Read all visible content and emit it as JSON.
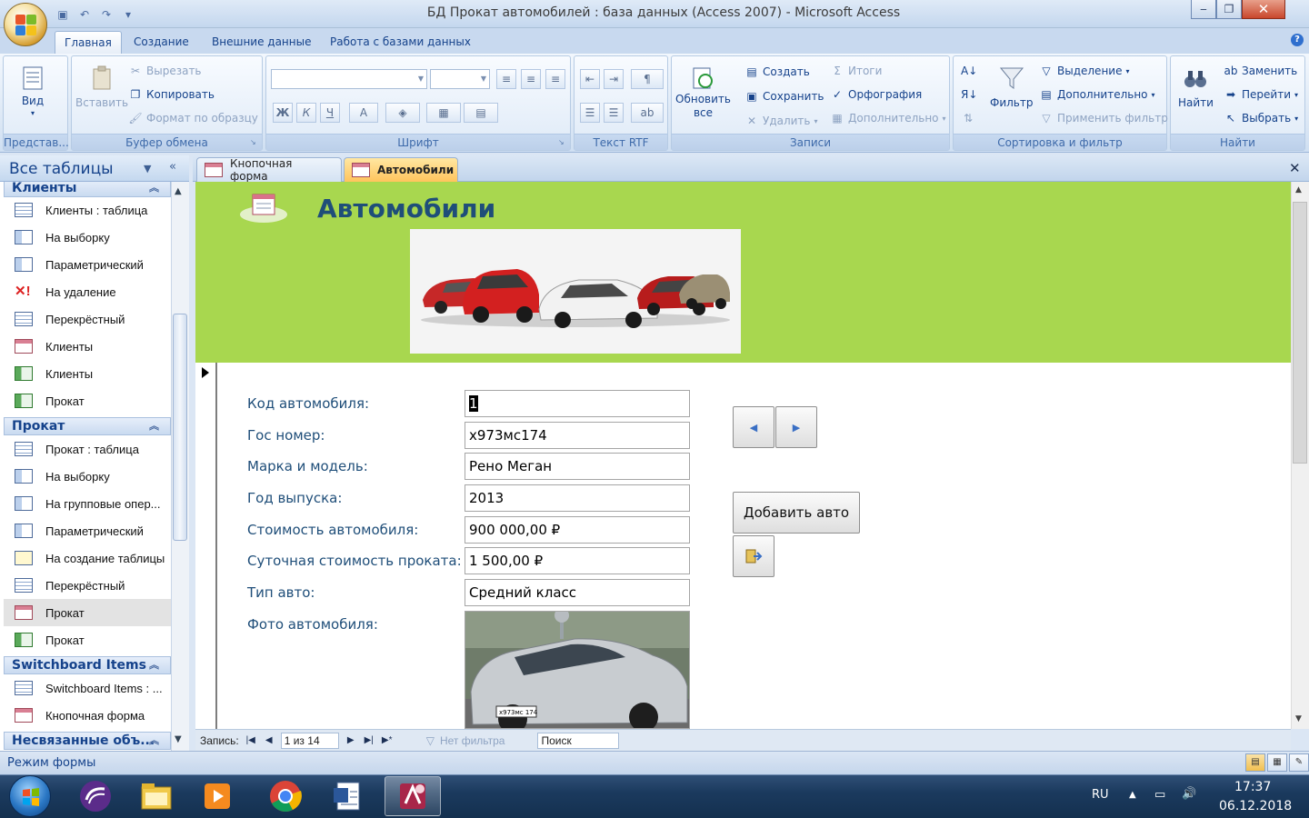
{
  "window": {
    "title": "БД Прокат автомобилей : база данных (Access 2007) - Microsoft Access",
    "minimize": "‒",
    "maximize": "❐",
    "close": "✕"
  },
  "ribbon_tabs": [
    "Главная",
    "Создание",
    "Внешние данные",
    "Работа с базами данных"
  ],
  "ribbon": {
    "views": {
      "label": "Представ...",
      "view_btn": "Вид"
    },
    "clipboard": {
      "label": "Буфер обмена",
      "paste": "Вставить",
      "cut": "Вырезать",
      "copy": "Копировать",
      "format_painter": "Формат по образцу"
    },
    "font": {
      "label": "Шрифт",
      "bold": "Ж",
      "italic": "К",
      "underline": "Ч",
      "fontcolor": "А"
    },
    "rtf": {
      "label": "Текст RTF"
    },
    "records": {
      "label": "Записи",
      "refresh": "Обновить",
      "refresh2": "все",
      "create": "Создать",
      "save": "Сохранить",
      "delete": "Удалить",
      "totals": "Итоги",
      "spelling": "Орфография",
      "more": "Дополнительно"
    },
    "sort_filter": {
      "label": "Сортировка и фильтр",
      "filter": "Фильтр",
      "selection": "Выделение",
      "advanced": "Дополнительно",
      "toggle": "Применить фильтр"
    },
    "find": {
      "label": "Найти",
      "find": "Найти",
      "replace": "Заменить",
      "goto": "Перейти",
      "select": "Выбрать"
    }
  },
  "nav": {
    "header": "Все таблицы",
    "groups": [
      {
        "title": "Клиенты",
        "items": [
          {
            "label": "Клиенты : таблица",
            "icon": "table-icon"
          },
          {
            "label": "На выборку",
            "icon": "query-icon"
          },
          {
            "label": "Параметрический",
            "icon": "query-icon"
          },
          {
            "label": "На удаление",
            "icon": "delete-query-icon"
          },
          {
            "label": "Перекрёстный",
            "icon": "crosstab-icon"
          },
          {
            "label": "Клиенты",
            "icon": "form-icon"
          },
          {
            "label": "Клиенты",
            "icon": "report-icon"
          },
          {
            "label": "Прокат",
            "icon": "report-icon"
          }
        ]
      },
      {
        "title": "Прокат",
        "items": [
          {
            "label": "Прокат : таблица",
            "icon": "table-icon"
          },
          {
            "label": "На выборку",
            "icon": "query-icon"
          },
          {
            "label": "На групповые опер...",
            "icon": "query-icon"
          },
          {
            "label": "Параметрический",
            "icon": "query-icon"
          },
          {
            "label": "На создание таблицы",
            "icon": "make-table-icon"
          },
          {
            "label": "Перекрёстный",
            "icon": "crosstab-icon"
          },
          {
            "label": "Прокат",
            "icon": "form-icon"
          },
          {
            "label": "Прокат",
            "icon": "report-icon"
          }
        ]
      },
      {
        "title": "Switchboard Items",
        "items": [
          {
            "label": "Switchboard Items : ...",
            "icon": "table-icon"
          },
          {
            "label": "Кнопочная форма",
            "icon": "form-icon"
          }
        ]
      },
      {
        "title": "Несвязанные объ...",
        "items": []
      }
    ]
  },
  "doc_tabs": [
    {
      "label": "Кнопочная форма",
      "active": false
    },
    {
      "label": "Автомобили",
      "active": true
    }
  ],
  "form": {
    "title": "Автомобили",
    "fields": [
      {
        "label": "Код автомобиля:",
        "value": "1"
      },
      {
        "label": "Гос номер:",
        "value": "х973мс174"
      },
      {
        "label": "Марка и модель:",
        "value": "Рено Меган"
      },
      {
        "label": "Год выпуска:",
        "value": "2013"
      },
      {
        "label": "Стоимость автомобиля:",
        "value": "900 000,00 ₽"
      },
      {
        "label": "Суточная стоимость проката:",
        "value": "1 500,00 ₽"
      },
      {
        "label": "Тип авто:",
        "value": "Средний класс"
      },
      {
        "label": "Фото автомобиля:",
        "value": ""
      }
    ],
    "plate_text": "х973мс 174",
    "add_button": "Добавить авто",
    "prev_btn": "◀",
    "next_btn": "▶"
  },
  "record_nav": {
    "label": "Запись:",
    "position": "1 из 14",
    "filter": "Нет фильтра",
    "search": "Поиск"
  },
  "status": {
    "text": "Режим формы"
  },
  "taskbar": {
    "lang": "RU",
    "time": "17:37",
    "date": "06.12.2018"
  },
  "colors": {
    "header_green": "#a8d74f",
    "title_blue": "#1f4e79",
    "active_tab": "#ffc45c"
  }
}
